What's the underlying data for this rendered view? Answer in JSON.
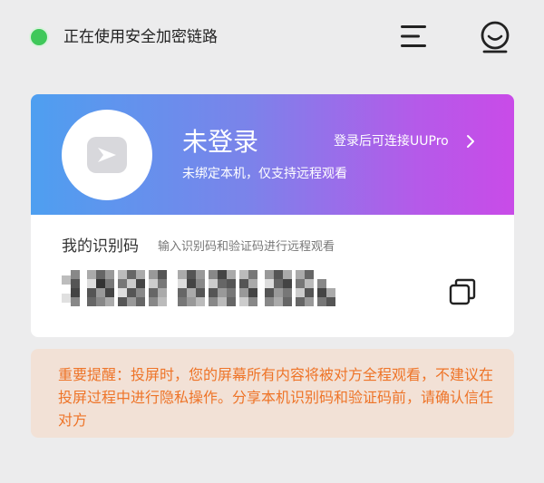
{
  "status": {
    "text": "正在使用安全加密链路",
    "color": "#3fc85a"
  },
  "header": {
    "menu_icon": "menu-icon",
    "avatar_icon": "avatar-icon"
  },
  "account": {
    "title": "未登录",
    "subtitle": "未绑定本机，仅支持远程观看",
    "link": "登录后可连接UUPro",
    "gradient_colors": [
      "#4e9ff0",
      "#c94be8"
    ]
  },
  "identity": {
    "label": "我的识别码",
    "hint": "输入识别码和验证码进行远程观看",
    "code_display": "pixelated",
    "copy_icon": "copy-icon"
  },
  "warning": {
    "text": "重要提醒：投屏时，您的屏幕所有内容将被对方全程观看，不建议在投屏过程中进行隐私操作。分享本机识别码和验证码前，请确认信任对方",
    "color": "#ee7428",
    "background": "#f2e1d6"
  }
}
